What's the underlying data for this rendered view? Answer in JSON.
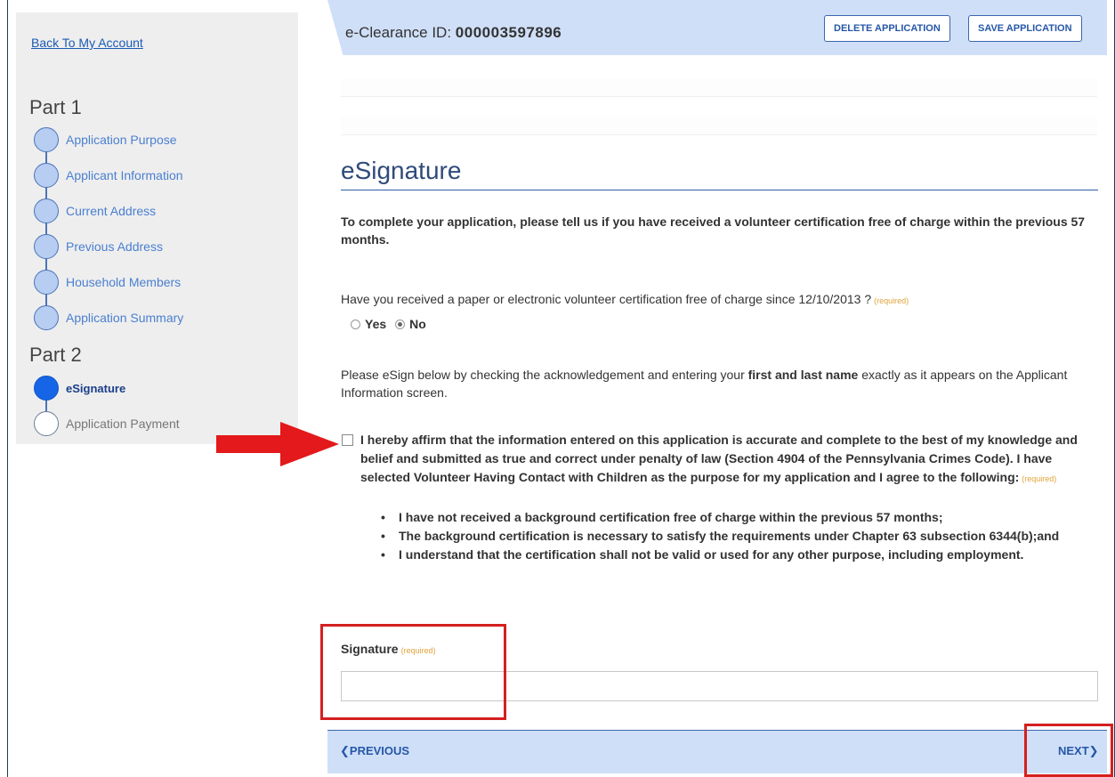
{
  "sidebar": {
    "back_link": "Back To My Account",
    "part1_title": "Part 1",
    "part2_title": "Part 2",
    "part1_steps": [
      {
        "label": "Application Purpose"
      },
      {
        "label": "Applicant Information"
      },
      {
        "label": "Current Address"
      },
      {
        "label": "Previous Address"
      },
      {
        "label": "Household Members"
      },
      {
        "label": "Application Summary"
      }
    ],
    "part2_steps": [
      {
        "label": "eSignature",
        "state": "active"
      },
      {
        "label": "Application Payment",
        "state": "pending"
      }
    ]
  },
  "header": {
    "clearance_label": "e-Clearance ID:",
    "clearance_id": "000003597896",
    "delete_button": "DELETE APPLICATION",
    "save_button": "SAVE APPLICATION"
  },
  "main": {
    "section_title": "eSignature",
    "intro": "To complete your application, please tell us if you have received a volunteer certification free of charge within the previous 57 months.",
    "question": "Have you received a paper or electronic volunteer certification free of charge since 12/10/2013 ?",
    "required": "(required)",
    "options": {
      "yes": "Yes",
      "no": "No",
      "selected": "No"
    },
    "instruction_before": "Please eSign below by checking the acknowledgement and entering your ",
    "instruction_emphasis": "first and last name",
    "instruction_after": " exactly as it appears on the Applicant Information screen.",
    "affirmation": "I hereby affirm that the information entered on this application is accurate and complete to the best of my knowledge and belief and submitted as true and correct under penalty of law (Section 4904 of the Pennsylvania Crimes Code). I have selected Volunteer Having Contact with Children as the purpose for my application and I agree to the following:",
    "affirmation_checked": false,
    "bullets": [
      "I have not received a background certification free of charge within the previous 57 months;",
      "The background certification is necessary to satisfy the requirements under Chapter 63 subsection 6344(b);and",
      "I understand that the certification shall not be valid or used for any other purpose, including employment."
    ],
    "signature_label": "Signature",
    "signature_value": ""
  },
  "footer": {
    "previous": "PREVIOUS",
    "next": "NEXT"
  },
  "colors": {
    "accent_blue": "#cfdff8",
    "step_complete": "#b7cdf1",
    "step_active": "#1565e6",
    "annotation_red": "#d42020",
    "required_orange": "#e0a33a"
  }
}
